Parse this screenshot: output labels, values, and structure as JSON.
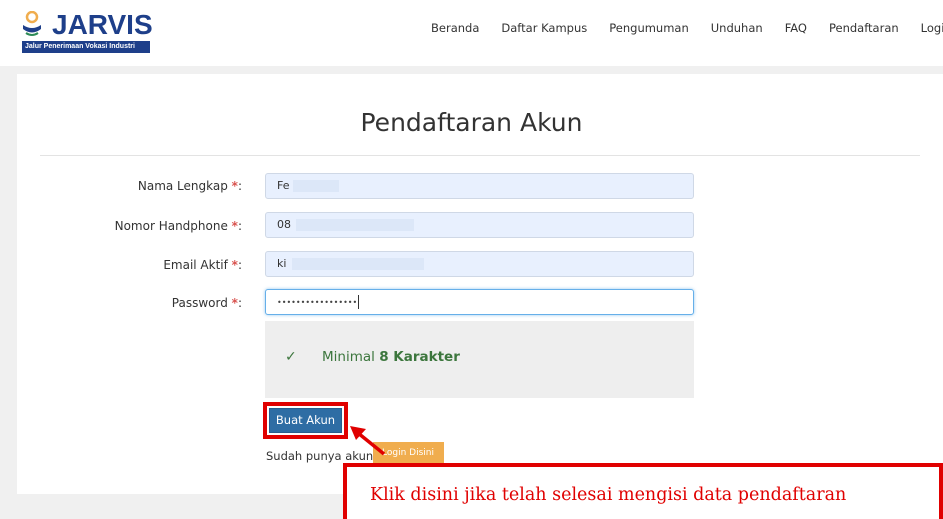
{
  "brand": {
    "name": "JARVIS",
    "tagline": "Jalur Penerimaan Vokasi Industri",
    "color": "#1e3f8a"
  },
  "nav": {
    "items": [
      "Beranda",
      "Daftar Kampus",
      "Pengumuman",
      "Unduhan",
      "FAQ",
      "Pendaftaran",
      "Login"
    ]
  },
  "form": {
    "title": "Pendaftaran Akun",
    "fields": [
      {
        "label": "Nama Lengkap",
        "required_mark": "*",
        "suffix": ":",
        "value": "Fe"
      },
      {
        "label": "Nomor Handphone",
        "required_mark": "*",
        "suffix": ":",
        "value": "08"
      },
      {
        "label": "Email Aktif",
        "required_mark": "*",
        "suffix": ":",
        "value": "ki"
      },
      {
        "label": "Password",
        "required_mark": "*",
        "suffix": ":",
        "value": "•••••••••••••••••"
      }
    ],
    "password_hint": {
      "check_icon": "check-icon",
      "prefix": "Minimal",
      "emphasis": "8 Karakter",
      "color": "#3c763d"
    },
    "submit_label": "Buat Akun",
    "have_account_text": "Sudah punya akun?",
    "login_button_label": "Login Disini"
  },
  "annotation": {
    "callout_text": "Klik disini jika telah selesai mengisi data pendaftaran",
    "color": "#e00000"
  }
}
